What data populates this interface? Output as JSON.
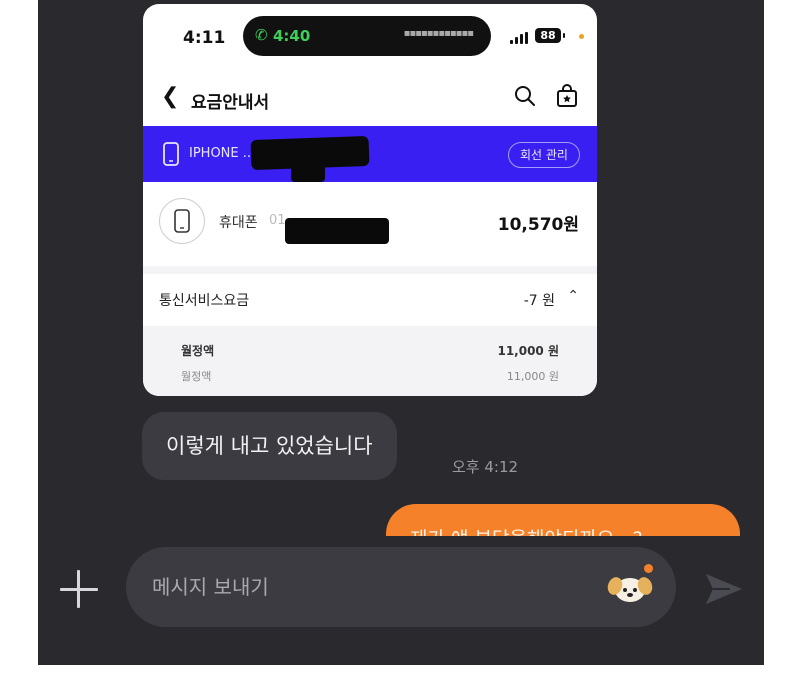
{
  "status_bar": {
    "clock": "4:11",
    "call_time": "4:40",
    "battery": "88"
  },
  "bill_screen": {
    "title": "요금안내서",
    "line": {
      "name": "IPHONE ...",
      "manage_label": "회선 관리"
    },
    "device": {
      "label": "휴대폰",
      "number": "01",
      "amount": "10,570원"
    },
    "service": {
      "label": "통신서비스요금",
      "amount": "-7 원"
    },
    "details": [
      {
        "label": "월정액",
        "amount": "11,000 원"
      },
      {
        "label": "월정액",
        "amount": "11,000 원"
      }
    ],
    "colors": {
      "line_bar": "#3a1ff2",
      "call_green": "#3ecf5a"
    }
  },
  "chat": {
    "received_message": "이렇게 내고 있었습니다",
    "received_time": "오후 4:12",
    "sent_message_partial": "제가 얘 부담을해야되까요 ..?",
    "colors": {
      "sent_bubble": "#f5822a",
      "received_bubble": "#3b3b41",
      "background": "#2a2a2e"
    }
  },
  "input_bar": {
    "placeholder": "메시지 보내기"
  },
  "icons": {
    "back": "chevron-left-icon",
    "search": "search-icon",
    "cart": "cart-icon",
    "phone": "phone-icon",
    "add": "plus-icon",
    "emoji": "emoticon-dog-icon",
    "send": "send-icon"
  }
}
